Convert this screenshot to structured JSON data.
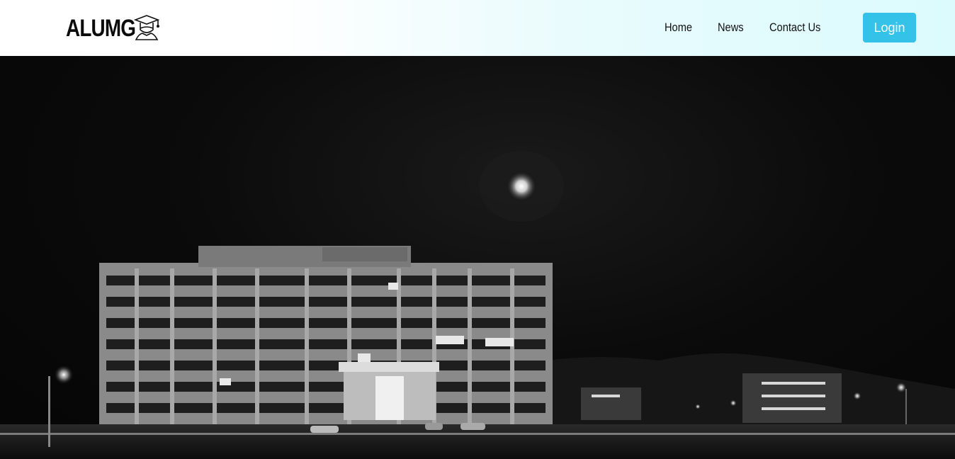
{
  "header": {
    "logo_text": "ALUMG",
    "logo_icon": "graduate-cap-icon",
    "nav": {
      "home": "Home",
      "news": "News",
      "contact": "Contact Us"
    },
    "login_label": "Login",
    "colors": {
      "accent": "#35c2e9"
    }
  },
  "hero": {
    "image": "night campus building photo (black and white)"
  }
}
